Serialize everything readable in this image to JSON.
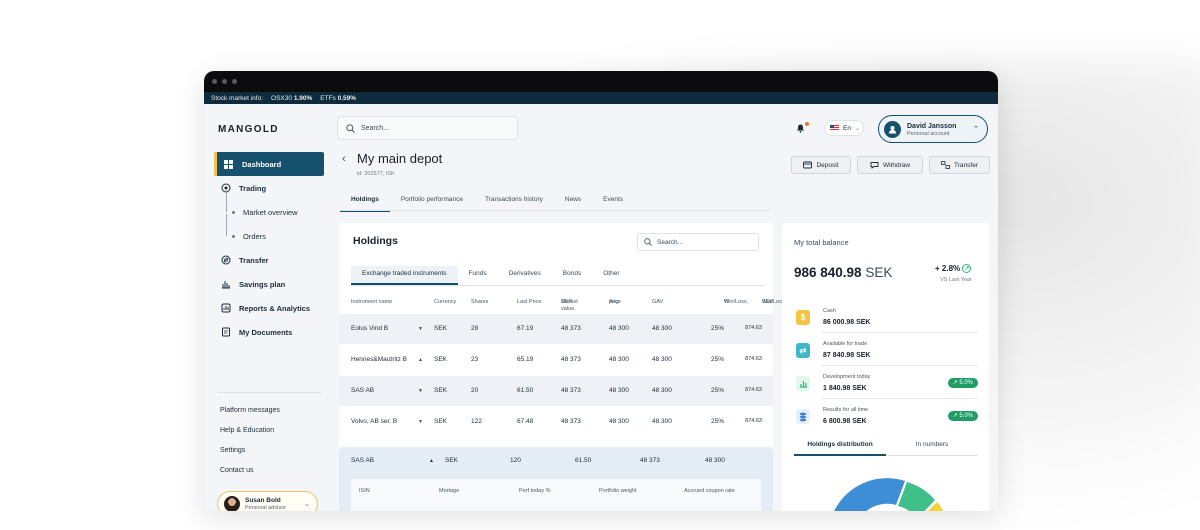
{
  "ticker": {
    "label": "Stock market info:",
    "items": [
      {
        "name": "OSX30",
        "value": "1.90%"
      },
      {
        "name": "ETFs",
        "value": "0.59%"
      }
    ]
  },
  "brand": "MANGOLD",
  "sidebar": {
    "items": [
      {
        "label": "Dashboard",
        "icon": "grid-icon"
      },
      {
        "label": "Trading",
        "icon": "trading-icon"
      },
      {
        "label": "Market overview"
      },
      {
        "label": "Orders"
      },
      {
        "label": "Transfer",
        "icon": "transfer-icon"
      },
      {
        "label": "Savings plan",
        "icon": "savings-chart-icon"
      },
      {
        "label": "Reports & Analytics",
        "icon": "reports-icon"
      },
      {
        "label": "My Documents",
        "icon": "documents-icon"
      }
    ],
    "links": [
      "Platform messages",
      "Help & Education",
      "Settings",
      "Contact us"
    ],
    "advisor": {
      "name": "Susan Bold",
      "role": "Personal advisor"
    }
  },
  "search": {
    "placeholder": "Search..."
  },
  "lang": "En",
  "user": {
    "name": "David Jansson",
    "role": "Personal account"
  },
  "depot": {
    "title": "My main depot",
    "id": "id: 202577, ISK"
  },
  "actions": {
    "deposit": "Deposit",
    "withdraw": "Withdraw",
    "transfer": "Transfer"
  },
  "tabs": [
    "Holdings",
    "Portfolio performance",
    "Transactions history",
    "News",
    "Events"
  ],
  "holdings": {
    "title": "Holdings",
    "search_placeholder": "Search...",
    "subtabs": [
      "Exchange traded instruments",
      "Funds",
      "Derivatives",
      "Bonds",
      "Other"
    ],
    "columns": {
      "instrument": "Instrument name",
      "currency": "Currency",
      "shares": "Shares",
      "last_price": "Last Price",
      "market_value": "Market value,",
      "market_value_2": "SEK",
      "avg": "Avg.",
      "avg_2": "price",
      "gav": "GAV",
      "winloss_pct": "Win/Loss,",
      "winloss_pct_2": "%",
      "winloss_sek": "Win/Loss",
      "winloss_sek_2": "SEK"
    },
    "rows": [
      {
        "name": "Eolus Vind B",
        "dir": "▼",
        "currency": "SEK",
        "shares": "28",
        "last": "67.19",
        "mv": "48 373",
        "avg": "48 300",
        "gav": "48 300",
        "wlp": "25%",
        "wls": "874.63"
      },
      {
        "name": "Hennes&Mautritz B",
        "dir": "▲",
        "currency": "SEK",
        "shares": "23",
        "last": "65.19",
        "mv": "48 373",
        "avg": "48 300",
        "gav": "48 300",
        "wlp": "25%",
        "wls": "874.63"
      },
      {
        "name": "SAS AB",
        "dir": "▼",
        "currency": "SEK",
        "shares": "20",
        "last": "61.50",
        "mv": "48 373",
        "avg": "48 300",
        "gav": "48 300",
        "wlp": "25%",
        "wls": "874.63"
      },
      {
        "name": "Volvo, AB ser. B",
        "dir": "▼",
        "currency": "SEK",
        "shares": "122",
        "last": "67.48",
        "mv": "48 373",
        "avg": "48 300",
        "gav": "48 300",
        "wlp": "25%",
        "wls": "874.63"
      }
    ],
    "expanded": {
      "name": "SAS AB",
      "dir": "▲",
      "currency": "SEK",
      "shares": "120",
      "last": "61.50",
      "mv": "48 373",
      "avg": "48 300",
      "detail_columns": [
        "ISIN",
        "Mortage",
        "Perf today %",
        "Portfolio weight",
        "Accrued coupon rate"
      ]
    }
  },
  "balance": {
    "title": "My total balance",
    "value": "986 840.98",
    "currency": "SEK",
    "change": "+ 2.8%",
    "change_note": "VS Last Year",
    "items": [
      {
        "label": "Cash",
        "value": "86 000.98 SEK",
        "icon": "cash-icon",
        "color": "#f6c343"
      },
      {
        "label": "Available for trade",
        "value": "87 840.98 SEK",
        "icon": "trade-icon",
        "color": "#3fb8c9"
      },
      {
        "label": "Development today",
        "value": "1 840.98 SEK",
        "icon": "bar-chart-icon",
        "color": "#2eb67d",
        "badge": "↗ 5.0%"
      },
      {
        "label": "Results for all time",
        "value": "6 800.98 SEK",
        "icon": "coins-icon",
        "color": "#3d7fd6",
        "badge": "↗ 5.0%"
      }
    ],
    "dist_tabs": [
      "Holdings distribution",
      "In numbers"
    ],
    "donut_colors": [
      "#3d8ed6",
      "#3fc08a",
      "#f2d13a"
    ]
  }
}
